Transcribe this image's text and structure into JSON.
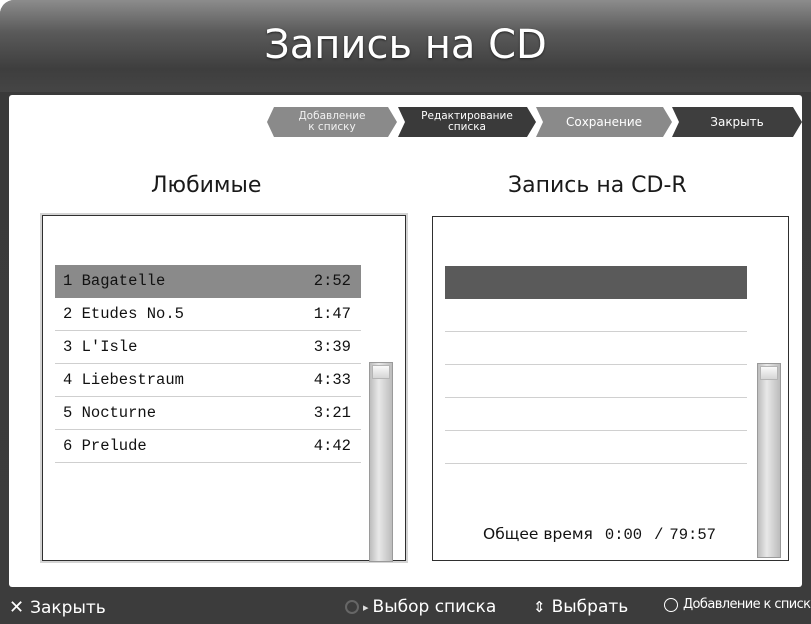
{
  "window": {
    "title": "Запись на CD"
  },
  "workflow": [
    {
      "label": "Добавление\nк списку",
      "state": "inactive"
    },
    {
      "label": "Редактирование\nсписка",
      "state": "active"
    },
    {
      "label": "Сохранение",
      "state": "inactive"
    },
    {
      "label": "Закрыть",
      "state": "active"
    }
  ],
  "favorites": {
    "title": "Любимые",
    "items": [
      {
        "name": "1 Bagatelle",
        "time": "2:52",
        "selected": true
      },
      {
        "name": "2 Etudes No.5",
        "time": "1:47"
      },
      {
        "name": "3 L'Isle",
        "time": "3:39"
      },
      {
        "name": "4 Liebestraum",
        "time": "4:33"
      },
      {
        "name": "5 Nocturne",
        "time": "3:21"
      },
      {
        "name": "6 Prelude",
        "time": "4:42"
      }
    ]
  },
  "cd_r": {
    "title": "Запись на CD-R",
    "rows": 6,
    "total_label": "Общее время",
    "total_used": "0:00",
    "total_capacity": "79:57",
    "separator": "/"
  },
  "help_bar": {
    "close": "Закрыть",
    "list_select": "Выбор списка",
    "select": "Выбрать",
    "add": "Добавление к списку"
  },
  "colors": {
    "selected_row_fav": "#8a8a8a",
    "selected_row_cd": "#5a5a5a",
    "step_active": "#3a3a3a",
    "step_inactive": "#8a8a8a"
  },
  "icons": {
    "close": "close-x-icon",
    "list_select": "arrow-right-icon",
    "select": "up-down-arrows-icon",
    "add": "circle-button-icon"
  }
}
